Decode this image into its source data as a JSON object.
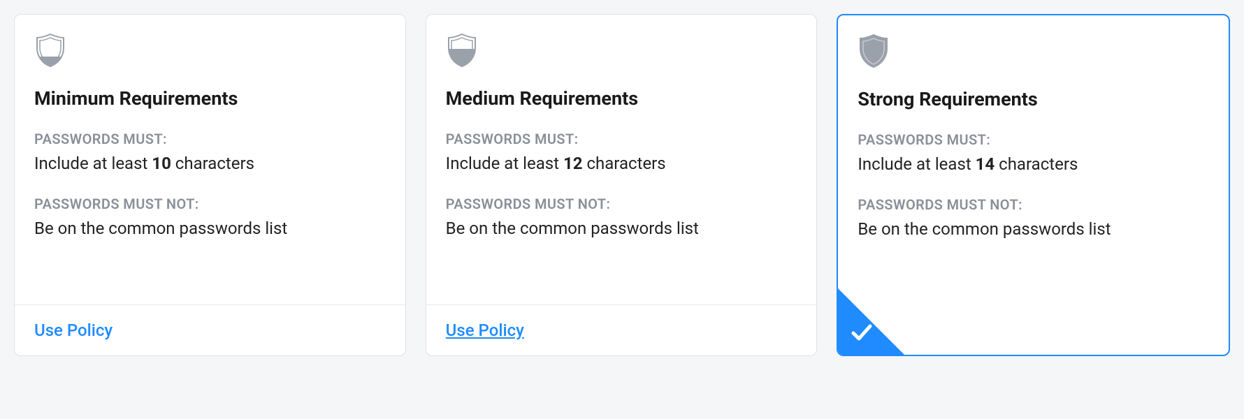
{
  "labels": {
    "must": "PASSWORDS MUST:",
    "mustNot": "PASSWORDS MUST NOT:",
    "usePolicy": "Use Policy",
    "mustPrefix": "Include at least ",
    "mustSuffix": " characters"
  },
  "colors": {
    "accent": "#1f8bff",
    "border": "#dfe3e8",
    "muted": "#8a8f98"
  },
  "cards": [
    {
      "id": "minimum",
      "title": "Minimum Requirements",
      "minChars": "10",
      "mustNotText": "Be on the common passwords list",
      "shieldFill": 0.25,
      "selected": false,
      "underlineFooter": false
    },
    {
      "id": "medium",
      "title": "Medium Requirements",
      "minChars": "12",
      "mustNotText": "Be on the common passwords list",
      "shieldFill": 0.5,
      "selected": false,
      "underlineFooter": true
    },
    {
      "id": "strong",
      "title": "Strong Requirements",
      "minChars": "14",
      "mustNotText": "Be on the common passwords list",
      "shieldFill": 1.0,
      "selected": true,
      "underlineFooter": false
    }
  ]
}
